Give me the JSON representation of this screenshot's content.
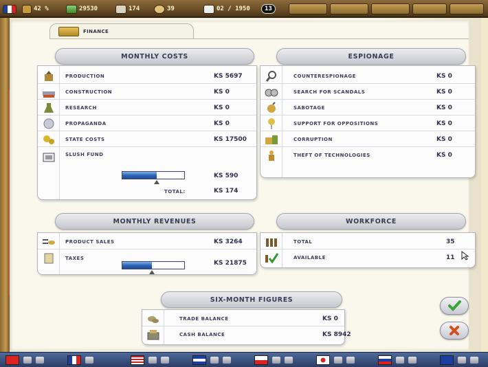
{
  "topbar": {
    "approval": "42 %",
    "money": "29530",
    "population": "174",
    "stat4": "39",
    "date": "02 / 1950",
    "turn": "13"
  },
  "tab": {
    "label": "FINANCE"
  },
  "monthly_costs": {
    "title": "MONTHLY COSTS",
    "rows": [
      {
        "icon": "production-icon",
        "label": "PRODUCTION",
        "value": "KS 5697"
      },
      {
        "icon": "construction-icon",
        "label": "CONSTRUCTION",
        "value": "KS 0"
      },
      {
        "icon": "research-icon",
        "label": "RESEARCH",
        "value": "KS 0"
      },
      {
        "icon": "propaganda-icon",
        "label": "PROPAGANDA",
        "value": "KS 0"
      },
      {
        "icon": "state-costs-icon",
        "label": "STATE COSTS",
        "value": "KS 17500"
      }
    ],
    "slush": {
      "label": "SLUSH FUND",
      "value": "KS 590",
      "level": 0.55
    },
    "total": {
      "label": "TOTAL:",
      "value": "KS 174"
    }
  },
  "espionage": {
    "title": "ESPIONAGE",
    "rows": [
      {
        "icon": "magnifier-icon",
        "label": "COUNTERESPIONAGE",
        "value": "KS 0"
      },
      {
        "icon": "binoculars-icon",
        "label": "SEARCH FOR SCANDALS",
        "value": "KS 0"
      },
      {
        "icon": "bomb-icon",
        "label": "SABOTAGE",
        "value": "KS 0"
      },
      {
        "icon": "balloon-icon",
        "label": "SUPPORT FOR OPPOSITIONS",
        "value": "KS 0"
      },
      {
        "icon": "bribe-icon",
        "label": "CORRUPTION",
        "value": "KS 0"
      },
      {
        "icon": "thief-icon",
        "label": "THEFT OF TECHNOLOGIES",
        "value": "KS 0"
      }
    ]
  },
  "monthly_revenues": {
    "title": "MONTHLY REVENUES",
    "rows": [
      {
        "icon": "product-sales-icon",
        "label": "PRODUCT SALES",
        "value": "KS 3264"
      }
    ],
    "taxes": {
      "label": "TAXES",
      "value": "KS 21875",
      "level": 0.48
    }
  },
  "workforce": {
    "title": "WORKFORCE",
    "rows": [
      {
        "icon": "workers-icon",
        "label": "TOTAL",
        "value": "35"
      },
      {
        "icon": "available-workers-icon",
        "label": "AVAILABLE",
        "value": "11"
      }
    ]
  },
  "six_month": {
    "title": "SIX-MONTH FIGURES",
    "rows": [
      {
        "icon": "coins-icon",
        "label": "TRADE BALANCE",
        "value": "KS 0"
      },
      {
        "icon": "cash-register-icon",
        "label": "CASH BALANCE",
        "value": "KS 8942"
      }
    ]
  },
  "colors": {
    "accent": "#3a3a56",
    "bar_fill": "#2e66b8",
    "confirm": "#3aa33a",
    "cancel": "#d0501c"
  }
}
